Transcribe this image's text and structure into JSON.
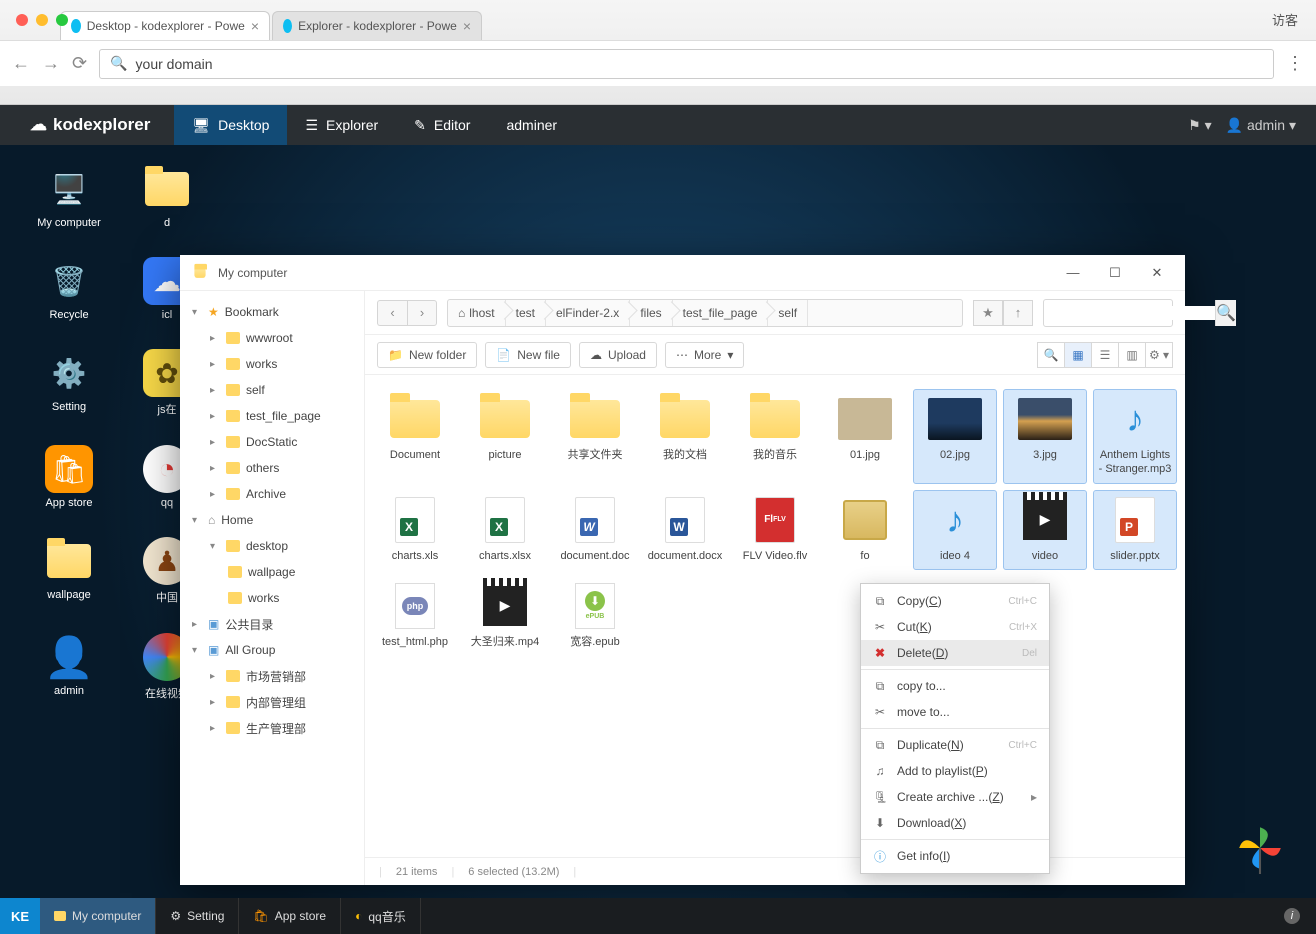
{
  "browser": {
    "guest_label": "访客",
    "tabs": [
      {
        "title": "Desktop - kodexplorer - Powe",
        "active": true
      },
      {
        "title": "Explorer - kodexplorer - Powe",
        "active": false
      }
    ],
    "address": "your domain"
  },
  "menubar": {
    "logo": "kodexplorer",
    "items": [
      "Desktop",
      "Explorer",
      "Editor",
      "adminer"
    ],
    "user": "admin"
  },
  "desktop_icons": {
    "col1": [
      "My computer",
      "Recycle",
      "Setting",
      "App store",
      "wallpage",
      "admin"
    ],
    "col2_partial": [
      "d",
      "icl",
      "js在",
      "qq",
      "中国",
      "在线视频"
    ]
  },
  "taskbar": {
    "start": "KE",
    "items": [
      "My computer",
      "Setting",
      "App store",
      "qq音乐"
    ]
  },
  "window": {
    "title": "My computer",
    "breadcrumb": [
      "lhost",
      "test",
      "elFinder-2.x",
      "files",
      "test_file_page",
      "self"
    ],
    "toolbar": {
      "new_folder": "New folder",
      "new_file": "New file",
      "upload": "Upload",
      "more": "More"
    },
    "search_placeholder": "",
    "status": {
      "items": "21 items",
      "selected": "6 selected (13.2M)"
    }
  },
  "sidebar_tree": {
    "bookmark": {
      "label": "Bookmark",
      "children": [
        "wwwroot",
        "works",
        "self",
        "test_file_page",
        "DocStatic",
        "others",
        "Archive"
      ]
    },
    "home": {
      "label": "Home",
      "children": [
        {
          "label": "desktop",
          "children": [
            "wallpage",
            "works"
          ]
        }
      ]
    },
    "public": {
      "label": "公共目录"
    },
    "allgroup": {
      "label": "All Group",
      "children": [
        "市场营销部",
        "内部管理组",
        "生产管理部"
      ]
    }
  },
  "files": [
    {
      "name": "Document",
      "type": "folder",
      "selected": false
    },
    {
      "name": "picture",
      "type": "folder",
      "selected": false
    },
    {
      "name": "共享文件夹",
      "type": "folder",
      "selected": false
    },
    {
      "name": "我的文档",
      "type": "folder",
      "selected": false
    },
    {
      "name": "我的音乐",
      "type": "folder",
      "selected": false
    },
    {
      "name": "01.jpg",
      "type": "image-desert",
      "selected": false
    },
    {
      "name": "02.jpg",
      "type": "image-sky",
      "selected": true
    },
    {
      "name": "3.jpg",
      "type": "image-sunset",
      "selected": true
    },
    {
      "name": "Anthem Lights - Stranger.mp3",
      "type": "audio",
      "selected": true
    },
    {
      "name": "charts.xls",
      "type": "xls",
      "selected": false
    },
    {
      "name": "charts.xlsx",
      "type": "xls",
      "selected": false
    },
    {
      "name": "document.doc",
      "type": "docold",
      "selected": false
    },
    {
      "name": "document.docx",
      "type": "docx",
      "selected": false
    },
    {
      "name": "FLV Video.flv",
      "type": "flv",
      "selected": false
    },
    {
      "name": "fo",
      "type": "image-file",
      "selected": false
    },
    {
      "name": "ideo 4",
      "type": "audio",
      "selected": true,
      "obscured": true
    },
    {
      "name": "video",
      "type": "video",
      "selected": true,
      "obscured": true
    },
    {
      "name": "slider.pptx",
      "type": "pptx",
      "selected": true
    },
    {
      "name": "test_html.php",
      "type": "php",
      "selected": false
    },
    {
      "name": "大圣归来.mp4",
      "type": "video",
      "selected": false
    },
    {
      "name": "宽容.epub",
      "type": "epub",
      "selected": false
    }
  ],
  "context_menu": [
    {
      "icon": "copy",
      "label": "Copy",
      "key": "C",
      "shortcut": "Ctrl+C"
    },
    {
      "icon": "cut",
      "label": "Cut",
      "key": "K",
      "shortcut": "Ctrl+X"
    },
    {
      "icon": "delete",
      "label": "Delete",
      "key": "D",
      "shortcut": "Del",
      "hovered": true
    },
    {
      "sep": true
    },
    {
      "icon": "copy",
      "label": "copy to..."
    },
    {
      "icon": "cut",
      "label": "move to..."
    },
    {
      "sep": true
    },
    {
      "icon": "duplicate",
      "label": "Duplicate",
      "key": "N",
      "shortcut": "Ctrl+C"
    },
    {
      "icon": "playlist",
      "label": "Add to playlist",
      "key": "P"
    },
    {
      "icon": "archive",
      "label": "Create archive ...",
      "key": "Z",
      "submenu": true
    },
    {
      "icon": "download",
      "label": "Download",
      "key": "X"
    },
    {
      "sep": true
    },
    {
      "icon": "info",
      "label": "Get info",
      "key": "I"
    }
  ]
}
